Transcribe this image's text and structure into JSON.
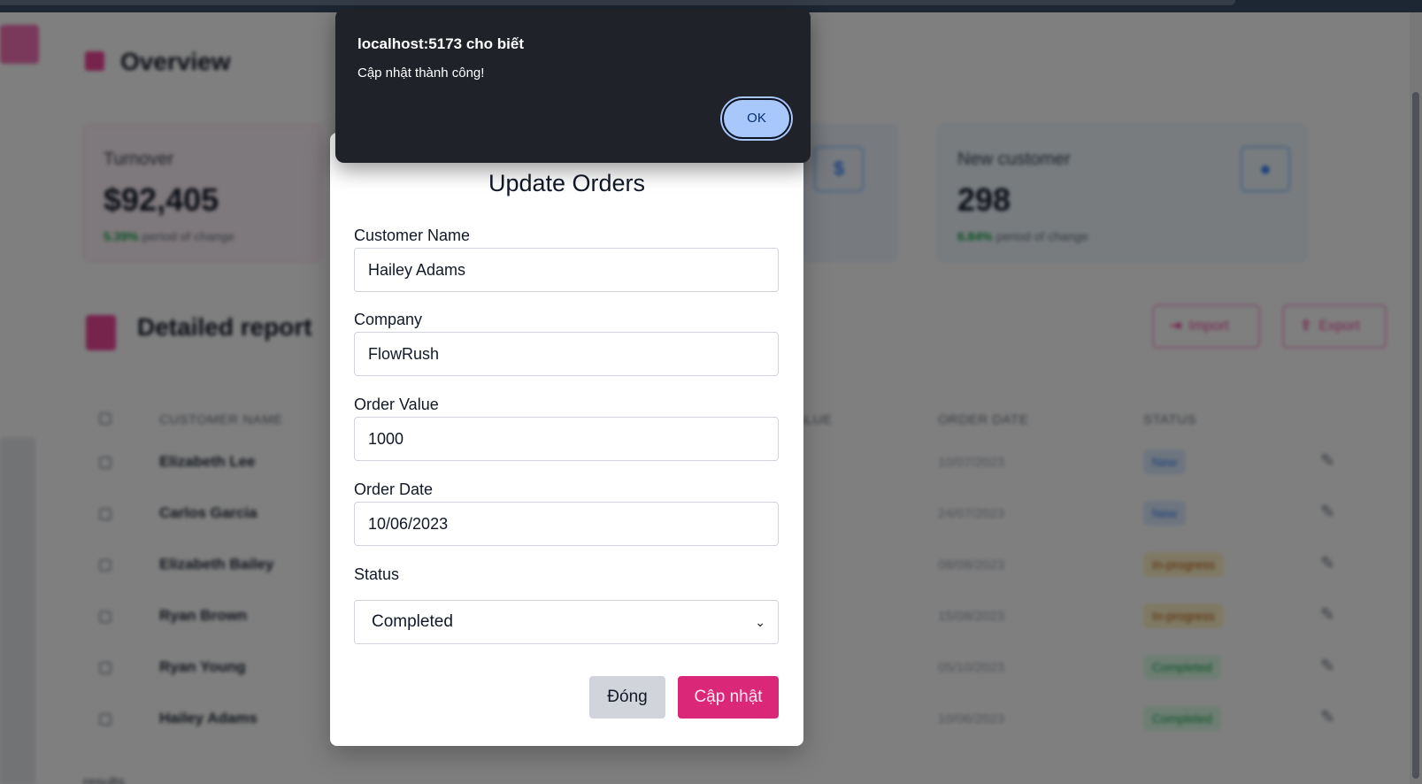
{
  "alert": {
    "title": "localhost:5173 cho biết",
    "message": "Cập nhật thành công!",
    "ok_label": "OK"
  },
  "modal": {
    "title": "Update Orders",
    "fields": {
      "customer_name": {
        "label": "Customer Name",
        "value": "Hailey Adams"
      },
      "company": {
        "label": "Company",
        "value": "FlowRush"
      },
      "order_value": {
        "label": "Order Value",
        "value": "1000"
      },
      "order_date": {
        "label": "Order Date",
        "value": "10/06/2023"
      },
      "status": {
        "label": "Status",
        "value": "Completed"
      }
    },
    "close_label": "Đóng",
    "update_label": "Cập nhật"
  },
  "background": {
    "overview_title": "Overview",
    "kpis": [
      {
        "label": "Turnover",
        "value": "$92,405",
        "change": "5.39%",
        "change_text": "period of change"
      },
      {
        "label": "New customer",
        "value": "298",
        "change": "6.84%",
        "change_text": "period of change"
      }
    ],
    "report_title": "Detailed report",
    "import_label": "Import",
    "export_label": "Export",
    "columns": {
      "customer_name": "CUSTOMER NAME",
      "order_value": "VALUE",
      "order_date": "ORDER DATE",
      "status": "STATUS"
    },
    "rows": [
      {
        "name": "Elizabeth Lee",
        "date": "10/07/2023",
        "status": "New"
      },
      {
        "name": "Carlos Garcia",
        "date": "24/07/2023",
        "status": "New"
      },
      {
        "name": "Elizabeth Bailey",
        "date": "08/08/2023",
        "status": "In-progress"
      },
      {
        "name": "Ryan Brown",
        "date": "15/08/2023",
        "status": "In-progress"
      },
      {
        "name": "Ryan Young",
        "date": "05/10/2023",
        "status": "Completed"
      },
      {
        "name": "Hailey Adams",
        "date": "10/06/2023",
        "status": "Completed"
      }
    ],
    "footer": "results"
  },
  "colors": {
    "accent_pink": "#db2777",
    "alert_bg": "#1f2329",
    "alert_button": "#a8c7fa"
  }
}
